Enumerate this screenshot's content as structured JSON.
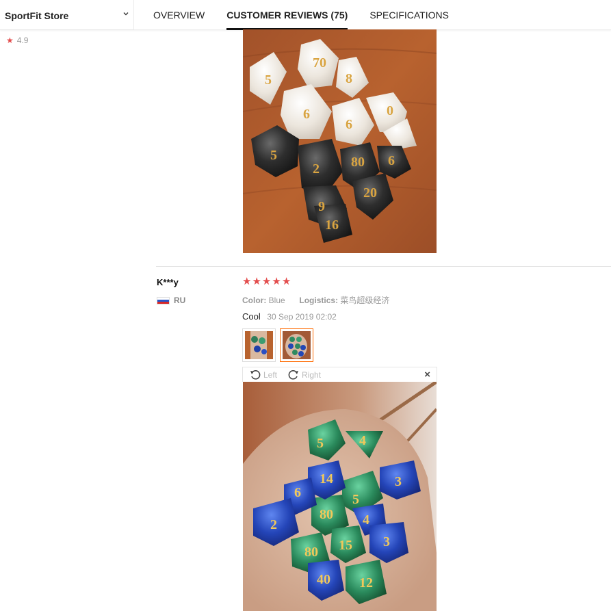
{
  "store": {
    "name": "SportFit Store",
    "rating": "4.9"
  },
  "tabs": [
    {
      "label": "OVERVIEW",
      "active": false
    },
    {
      "label": "CUSTOMER REVIEWS (75)",
      "active": true
    },
    {
      "label": "SPECIFICATIONS",
      "active": false
    }
  ],
  "review": {
    "reviewer": "K***y",
    "country": "RU",
    "stars": 5,
    "star_glyphs": [
      "★",
      "★",
      "★",
      "★",
      "★"
    ],
    "color_label": "Color:",
    "color_value": "Blue",
    "logistics_label": "Logistics:",
    "logistics_value": "菜鸟超级经济",
    "feedback": "Cool",
    "date": "30 Sep 2019 02:02"
  },
  "viewer": {
    "rotate_left": "Left",
    "rotate_right": "Right",
    "close_glyph": "×"
  },
  "icons": {
    "star": "★",
    "rotate_left": "rotate-left-icon",
    "rotate_right": "rotate-right-icon",
    "close": "close-icon",
    "chevron": "chevron-down-icon"
  },
  "colors": {
    "accent_star": "#e34d4d",
    "thumb_selected_border": "#ff6a00",
    "muted_text": "#999999"
  }
}
